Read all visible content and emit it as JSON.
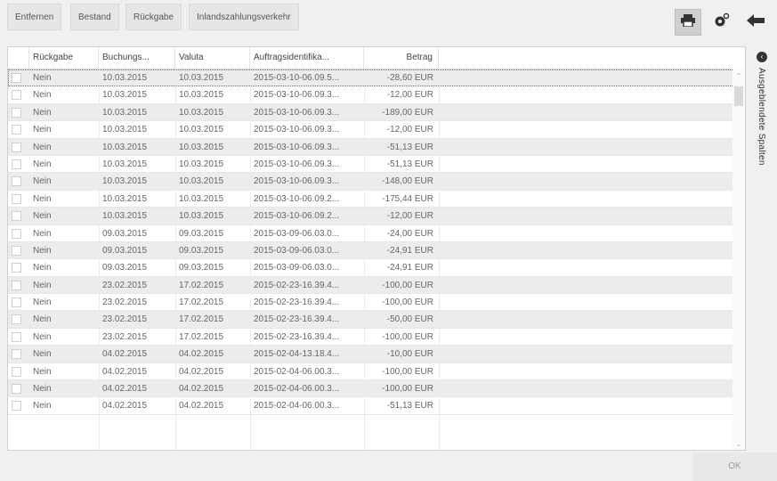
{
  "toolbar": {
    "buttons": [
      "Entfernen",
      "Bestand",
      "Rückgabe",
      "Inlandszahlungsverkehr"
    ],
    "icons": [
      "print-icon",
      "settings-icon",
      "back-arrow-icon"
    ]
  },
  "table": {
    "columns": [
      "Rückgabe",
      "Buchungs...",
      "Valuta",
      "Auftragsidentifika...",
      "Betrag"
    ],
    "rows": [
      [
        "Nein",
        "10.03.2015",
        "10.03.2015",
        "2015-03-10-06.09.5...",
        "-28,60 EUR"
      ],
      [
        "Nein",
        "10.03.2015",
        "10.03.2015",
        "2015-03-10-06.09.3...",
        "-12,00 EUR"
      ],
      [
        "Nein",
        "10.03.2015",
        "10.03.2015",
        "2015-03-10-06.09.3...",
        "-189,00 EUR"
      ],
      [
        "Nein",
        "10.03.2015",
        "10.03.2015",
        "2015-03-10-06.09.3...",
        "-12,00 EUR"
      ],
      [
        "Nein",
        "10.03.2015",
        "10.03.2015",
        "2015-03-10-06.09.3...",
        "-51,13 EUR"
      ],
      [
        "Nein",
        "10.03.2015",
        "10.03.2015",
        "2015-03-10-06.09.3...",
        "-51,13 EUR"
      ],
      [
        "Nein",
        "10.03.2015",
        "10.03.2015",
        "2015-03-10-06.09.3...",
        "-148,00 EUR"
      ],
      [
        "Nein",
        "10.03.2015",
        "10.03.2015",
        "2015-03-10-06.09.2...",
        "-175,44 EUR"
      ],
      [
        "Nein",
        "10.03.2015",
        "10.03.2015",
        "2015-03-10-06.09.2...",
        "-12,00 EUR"
      ],
      [
        "Nein",
        "09.03.2015",
        "09.03.2015",
        "2015-03-09-06.03.0...",
        "-24,00 EUR"
      ],
      [
        "Nein",
        "09.03.2015",
        "09.03.2015",
        "2015-03-09-06.03.0...",
        "-24,91 EUR"
      ],
      [
        "Nein",
        "09.03.2015",
        "09.03.2015",
        "2015-03-09-06.03.0...",
        "-24,91 EUR"
      ],
      [
        "Nein",
        "23.02.2015",
        "17.02.2015",
        "2015-02-23-16.39.4...",
        "-100,00 EUR"
      ],
      [
        "Nein",
        "23.02.2015",
        "17.02.2015",
        "2015-02-23-16.39.4...",
        "-100,00 EUR"
      ],
      [
        "Nein",
        "23.02.2015",
        "17.02.2015",
        "2015-02-23-16.39.4...",
        "-50,00 EUR"
      ],
      [
        "Nein",
        "23.02.2015",
        "17.02.2015",
        "2015-02-23-16.39.4...",
        "-100,00 EUR"
      ],
      [
        "Nein",
        "04.02.2015",
        "04.02.2015",
        "2015-02-04-13.18.4...",
        "-10,00 EUR"
      ],
      [
        "Nein",
        "04.02.2015",
        "04.02.2015",
        "2015-02-04-06.00.3...",
        "-100,00 EUR"
      ],
      [
        "Nein",
        "04.02.2015",
        "04.02.2015",
        "2015-02-04-06.00.3...",
        "-100,00 EUR"
      ],
      [
        "Nein",
        "04.02.2015",
        "04.02.2015",
        "2015-02-04-06.00.3...",
        "-51,13 EUR"
      ]
    ]
  },
  "sidebar": {
    "hidden_columns_label": "Ausgeblendete Spalten"
  },
  "footer": {
    "ok_label": "OK"
  }
}
